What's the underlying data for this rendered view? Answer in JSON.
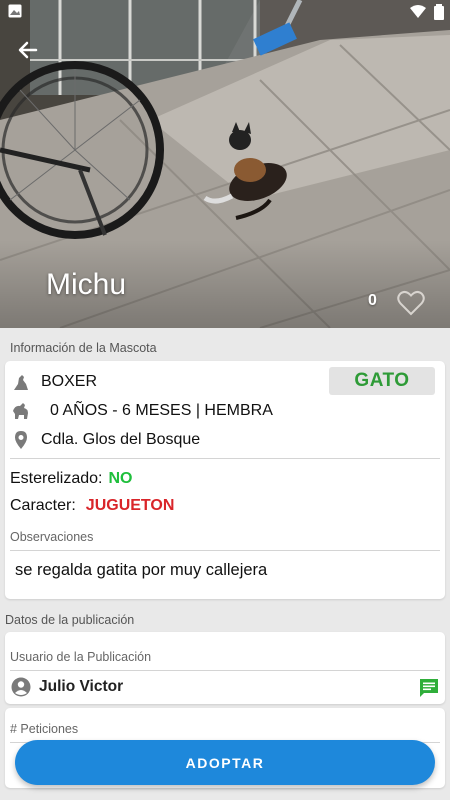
{
  "pet": {
    "name": "Michu",
    "likes": "0",
    "type_badge": "GATO",
    "breed": "BOXER",
    "age_sex": "0 AÑOS - 6 MESES | HEMBRA",
    "location": "Cdla. Glos del Bosque"
  },
  "info_section": {
    "title": "Información de la Mascota",
    "sterilized_label": "Esterelizado:",
    "sterilized_value": "NO",
    "character_label": "Caracter:",
    "character_value": "JUGUETON",
    "observations_label": "Observaciones",
    "observations_text": "se regalda gatita por muy callejera"
  },
  "publication_section": {
    "title": "Datos de la publicación",
    "user_label": "Usuario de la Publicación",
    "user_name": "Julio Victor",
    "requests_label": "# Peticiones"
  },
  "actions": {
    "adopt_label": "ADOPTAR"
  },
  "colors": {
    "accent_blue": "#1e88db",
    "badge_green": "#2e9b37",
    "value_green": "#1fbf3c",
    "value_red": "#d9252a",
    "chat_icon_green": "#2fae3a"
  },
  "icons": [
    "image-icon",
    "wifi-icon",
    "battery-icon",
    "back-arrow-icon",
    "heart-outline-icon",
    "dog-breed-icon",
    "dog-age-icon",
    "location-pin-icon",
    "account-circle-icon",
    "chat-icon"
  ]
}
